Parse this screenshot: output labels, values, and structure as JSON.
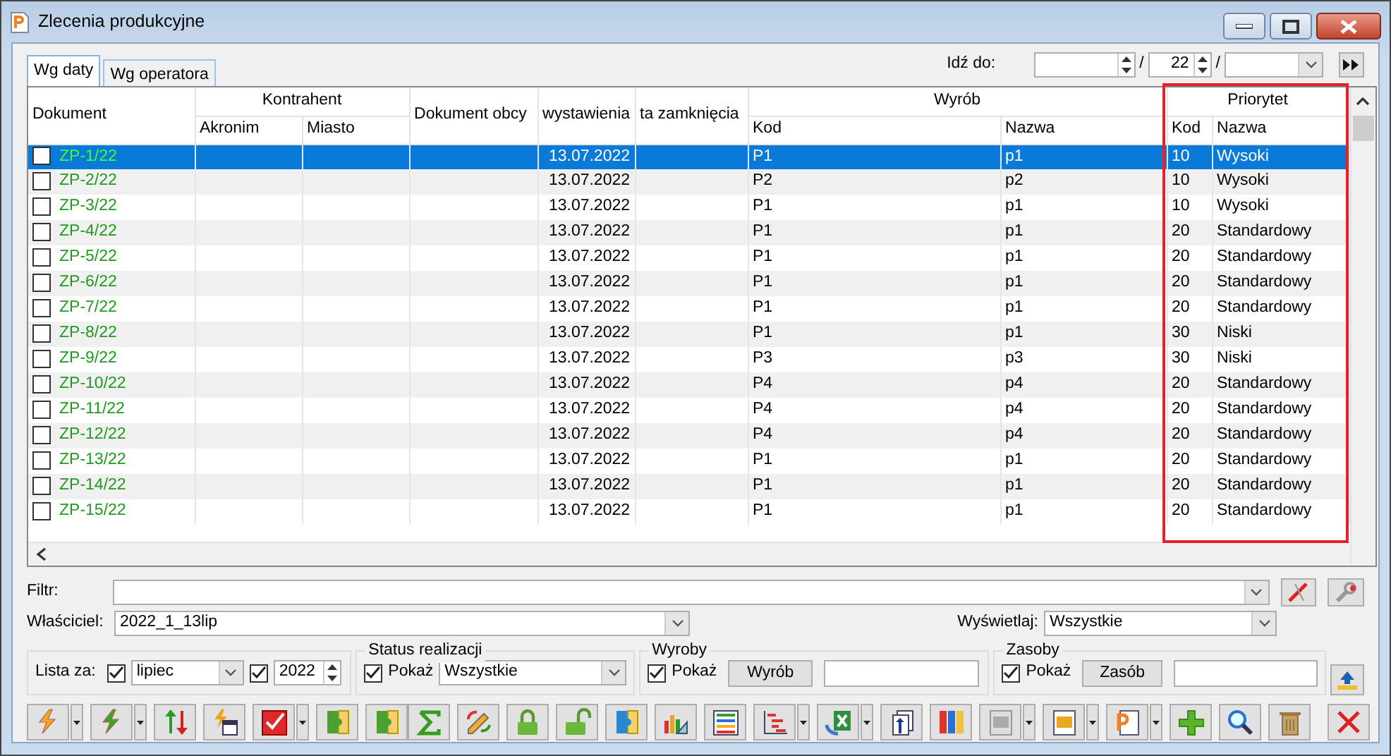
{
  "window": {
    "title": "Zlecenia produkcyjne"
  },
  "tabs": [
    {
      "label": "Wg daty",
      "selected": true
    },
    {
      "label": "Wg operatora",
      "selected": false
    }
  ],
  "goto": {
    "label": "Idź do:",
    "separators": [
      "/",
      "/"
    ],
    "number": "22"
  },
  "table": {
    "header_groups": [
      {
        "label": "Dokument"
      },
      {
        "label": "Kontrahent",
        "columns": [
          "Akronim",
          "Miasto"
        ]
      },
      {
        "label": "Dokument obcy"
      },
      {
        "label": "wystawienia"
      },
      {
        "label": "ta zamknięcia"
      },
      {
        "label": "Wyrób",
        "columns": [
          "Kod",
          "Nazwa"
        ]
      },
      {
        "label": "Priorytet",
        "columns": [
          "Kod",
          "Nazwa"
        ],
        "highlighted": true
      }
    ],
    "rows": [
      {
        "document": "ZP-1/22",
        "checked": false,
        "selected": true,
        "issued": "13.07.2022",
        "product_code": "P1",
        "product_name": "p1",
        "priority_code": "10",
        "priority_name": "Wysoki"
      },
      {
        "document": "ZP-2/22",
        "checked": false,
        "selected": false,
        "issued": "13.07.2022",
        "product_code": "P2",
        "product_name": "p2",
        "priority_code": "10",
        "priority_name": "Wysoki"
      },
      {
        "document": "ZP-3/22",
        "checked": false,
        "selected": false,
        "issued": "13.07.2022",
        "product_code": "P1",
        "product_name": "p1",
        "priority_code": "10",
        "priority_name": "Wysoki"
      },
      {
        "document": "ZP-4/22",
        "checked": false,
        "selected": false,
        "issued": "13.07.2022",
        "product_code": "P1",
        "product_name": "p1",
        "priority_code": "20",
        "priority_name": "Standardowy"
      },
      {
        "document": "ZP-5/22",
        "checked": false,
        "selected": false,
        "issued": "13.07.2022",
        "product_code": "P1",
        "product_name": "p1",
        "priority_code": "20",
        "priority_name": "Standardowy"
      },
      {
        "document": "ZP-6/22",
        "checked": false,
        "selected": false,
        "issued": "13.07.2022",
        "product_code": "P1",
        "product_name": "p1",
        "priority_code": "20",
        "priority_name": "Standardowy"
      },
      {
        "document": "ZP-7/22",
        "checked": false,
        "selected": false,
        "issued": "13.07.2022",
        "product_code": "P1",
        "product_name": "p1",
        "priority_code": "20",
        "priority_name": "Standardowy"
      },
      {
        "document": "ZP-8/22",
        "checked": false,
        "selected": false,
        "issued": "13.07.2022",
        "product_code": "P1",
        "product_name": "p1",
        "priority_code": "30",
        "priority_name": "Niski"
      },
      {
        "document": "ZP-9/22",
        "checked": false,
        "selected": false,
        "issued": "13.07.2022",
        "product_code": "P3",
        "product_name": "p3",
        "priority_code": "30",
        "priority_name": "Niski"
      },
      {
        "document": "ZP-10/22",
        "checked": false,
        "selected": false,
        "issued": "13.07.2022",
        "product_code": "P4",
        "product_name": "p4",
        "priority_code": "20",
        "priority_name": "Standardowy"
      },
      {
        "document": "ZP-11/22",
        "checked": false,
        "selected": false,
        "issued": "13.07.2022",
        "product_code": "P4",
        "product_name": "p4",
        "priority_code": "20",
        "priority_name": "Standardowy"
      },
      {
        "document": "ZP-12/22",
        "checked": false,
        "selected": false,
        "issued": "13.07.2022",
        "product_code": "P4",
        "product_name": "p4",
        "priority_code": "20",
        "priority_name": "Standardowy"
      },
      {
        "document": "ZP-13/22",
        "checked": false,
        "selected": false,
        "issued": "13.07.2022",
        "product_code": "P1",
        "product_name": "p1",
        "priority_code": "20",
        "priority_name": "Standardowy"
      },
      {
        "document": "ZP-14/22",
        "checked": false,
        "selected": false,
        "issued": "13.07.2022",
        "product_code": "P1",
        "product_name": "p1",
        "priority_code": "20",
        "priority_name": "Standardowy"
      },
      {
        "document": "ZP-15/22",
        "checked": false,
        "selected": false,
        "issued": "13.07.2022",
        "product_code": "P1",
        "product_name": "p1",
        "priority_code": "20",
        "priority_name": "Standardowy"
      }
    ]
  },
  "filter": {
    "label": "Filtr:"
  },
  "owner": {
    "label": "Właściciel:",
    "value": "2022_1_13lip"
  },
  "display": {
    "label": "Wyświetlaj:",
    "value": "Wszystkie"
  },
  "period": {
    "label": "Lista za:",
    "month_checked": true,
    "month": "lipiec",
    "year_checked": true,
    "year": "2022"
  },
  "status": {
    "title": "Status realizacji",
    "show_label": "Pokaż",
    "show_checked": true,
    "value": "Wszystkie"
  },
  "products": {
    "title": "Wyroby",
    "show_label": "Pokaż",
    "show_checked": true,
    "button": "Wyrób"
  },
  "resources": {
    "title": "Zasoby",
    "show_label": "Pokaż",
    "show_checked": true,
    "button": "Zasób"
  }
}
